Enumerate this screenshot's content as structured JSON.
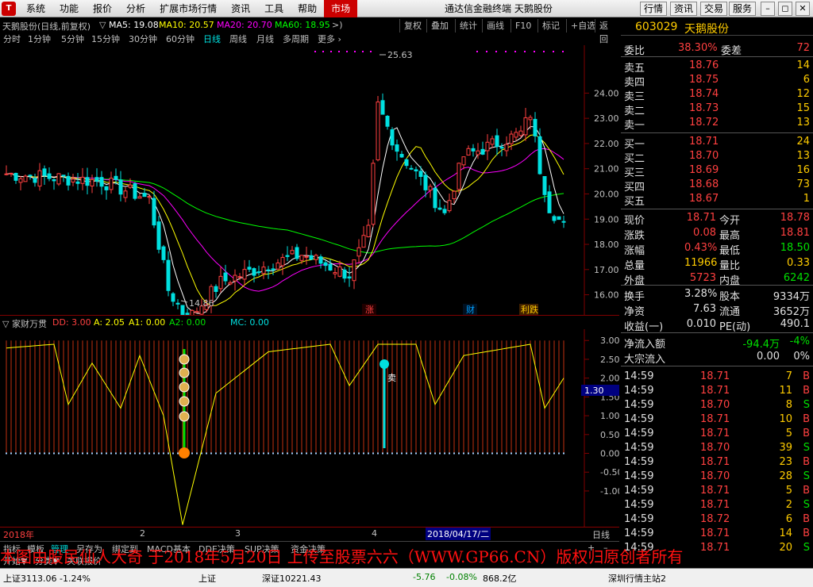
{
  "menu": {
    "logo": "T",
    "items": [
      "系统",
      "功能",
      "报价",
      "分析",
      "扩展市场行情",
      "资讯",
      "工具",
      "帮助"
    ],
    "market": "市场",
    "app_title": "通达信金融终端  天鹅股份",
    "right_buttons": [
      "行情",
      "资讯",
      "交易",
      "服务"
    ],
    "window_buttons": [
      "–",
      "◻",
      "✕"
    ]
  },
  "toolbar": {
    "stock_label": "天鹅股份(日线,前复权)",
    "ma5": "MA5: 19.08",
    "ma10": "MA10: 20.57",
    "ma20": "MA20: 20.70",
    "ma60": "MA60: 18.95",
    "buttons": [
      "复权",
      "叠加",
      "统计",
      "画线",
      "F10",
      "标记",
      "+自选",
      "返回"
    ]
  },
  "periods": [
    "分时",
    "1分钟",
    "5分钟",
    "15分钟",
    "30分钟",
    "60分钟",
    "日线",
    "周线",
    "月线",
    "多周期",
    "更多 ›"
  ],
  "active_period": "日线",
  "price_axis": [
    "24.00",
    "23.00",
    "22.00",
    "21.00",
    "20.00",
    "19.00",
    "18.00",
    "17.00",
    "16.00"
  ],
  "annotations": {
    "high": "25.63",
    "low": "14.86",
    "events": [
      "涨",
      "财",
      "利跌"
    ]
  },
  "indicator": {
    "name": "▽ 家财万贯",
    "dd": "DD: 3.00",
    "a": "A: 2.05",
    "a1": "A1: 0.00",
    "a2": "A2: 0.00",
    "mc": "MC: 0.00",
    "axis": [
      "3.00",
      "2.50",
      "2.00",
      "1.50",
      "1.00",
      "0.50",
      "0.00",
      "-0.50",
      "-1.00"
    ],
    "cursor_value": "1.30",
    "sell_label": "卖"
  },
  "dates": {
    "year": "2018年",
    "m2": "2",
    "m3": "3",
    "m4": "4",
    "cursor": "2018/04/17/二",
    "period": "日线"
  },
  "bottom_tabs": [
    "指标",
    "模板",
    "管理",
    "另存为",
    "绑定到",
    "MACD基本",
    "DDE决策",
    "SUP决策",
    "资金决策"
  ],
  "bottom_row2": [
    "开始▼",
    "分类▼",
    "关联报价"
  ],
  "quote": {
    "code": "603029",
    "name": "天鹅股份",
    "weibi_label": "委比",
    "weibi": "38.30%",
    "weicha_label": "委差",
    "weicha": "72",
    "asks": [
      {
        "label": "卖五",
        "price": "18.76",
        "vol": "14"
      },
      {
        "label": "卖四",
        "price": "18.75",
        "vol": "6"
      },
      {
        "label": "卖三",
        "price": "18.74",
        "vol": "12"
      },
      {
        "label": "卖二",
        "price": "18.73",
        "vol": "15"
      },
      {
        "label": "卖一",
        "price": "18.72",
        "vol": "13"
      }
    ],
    "bids": [
      {
        "label": "买一",
        "price": "18.71",
        "vol": "24"
      },
      {
        "label": "买二",
        "price": "18.70",
        "vol": "13"
      },
      {
        "label": "买三",
        "price": "18.69",
        "vol": "16"
      },
      {
        "label": "买四",
        "price": "18.68",
        "vol": "73"
      },
      {
        "label": "买五",
        "price": "18.67",
        "vol": "1"
      }
    ],
    "stats": [
      {
        "l1": "现价",
        "v1": "18.71",
        "c1": "red",
        "l2": "今开",
        "v2": "18.78",
        "c2": "red"
      },
      {
        "l1": "涨跌",
        "v1": "0.08",
        "c1": "red",
        "l2": "最高",
        "v2": "18.81",
        "c2": "red"
      },
      {
        "l1": "涨幅",
        "v1": "0.43%",
        "c1": "red",
        "l2": "最低",
        "v2": "18.50",
        "c2": "green"
      },
      {
        "l1": "总量",
        "v1": "11966",
        "c1": "yel",
        "l2": "量比",
        "v2": "0.33",
        "c2": "yel"
      },
      {
        "l1": "外盘",
        "v1": "5723",
        "c1": "red",
        "l2": "内盘",
        "v2": "6242",
        "c2": "green"
      }
    ],
    "stats2": [
      {
        "l1": "换手",
        "v1": "3.28%",
        "l2": "股本",
        "v2": "9334万"
      },
      {
        "l1": "净资",
        "v1": "7.63",
        "l2": "流通",
        "v2": "3652万"
      },
      {
        "l1": "收益(一)",
        "v1": "0.010",
        "l2": "PE(动)",
        "v2": "490.1"
      }
    ],
    "flow": [
      {
        "label": "净流入额",
        "v1": "-94.4万",
        "v2": "-4%"
      },
      {
        "label": "大宗流入",
        "v1": "0.00",
        "v2": "0%"
      }
    ],
    "ticks": [
      {
        "t": "14:59",
        "p": "18.71",
        "v": "7",
        "s": "B"
      },
      {
        "t": "14:59",
        "p": "18.71",
        "v": "11",
        "s": "B"
      },
      {
        "t": "14:59",
        "p": "18.70",
        "v": "8",
        "s": "S"
      },
      {
        "t": "14:59",
        "p": "18.71",
        "v": "10",
        "s": "B"
      },
      {
        "t": "14:59",
        "p": "18.71",
        "v": "5",
        "s": "B"
      },
      {
        "t": "14:59",
        "p": "18.70",
        "v": "39",
        "s": "S"
      },
      {
        "t": "14:59",
        "p": "18.71",
        "v": "23",
        "s": "B"
      },
      {
        "t": "14:59",
        "p": "18.70",
        "v": "28",
        "s": "S"
      },
      {
        "t": "14:59",
        "p": "18.71",
        "v": "5",
        "s": "B"
      },
      {
        "t": "14:59",
        "p": "18.71",
        "v": "2",
        "s": "S"
      },
      {
        "t": "14:59",
        "p": "18.72",
        "v": "6",
        "s": "B"
      },
      {
        "t": "14:59",
        "p": "18.71",
        "v": "14",
        "s": "B"
      },
      {
        "t": "14:59",
        "p": "18.71",
        "v": "20",
        "s": "S"
      }
    ]
  },
  "watermark": "本图由股民仙人大奇 于2018年5月20日 上传至股票六六（WWW.GP66.CN）版权归原创者所有",
  "status": {
    "items": [
      "上证3113.06  -1.24%",
      "上证",
      "深证10221.43",
      "-5.76",
      "-0.08%",
      "868.2亿",
      "深圳行情主站2"
    ]
  },
  "colors": {
    "up": "#ff4040",
    "down": "#00e0e0",
    "ma5": "#ffffff",
    "ma10": "#ffff00",
    "ma20": "#ff00ff",
    "ma60": "#00ff00"
  }
}
